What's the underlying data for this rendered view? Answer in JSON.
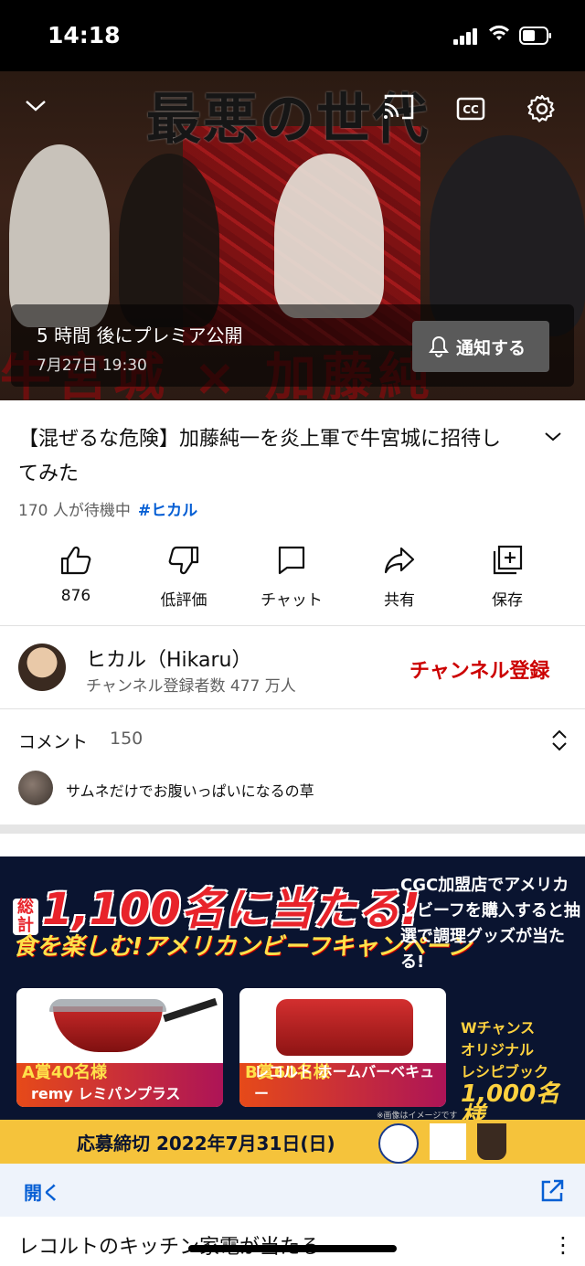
{
  "status_bar": {
    "time": "14:18"
  },
  "video": {
    "overlay_title": "最悪の世代",
    "overlay_bottom": "牛宮城 × 加藤純",
    "premiere_line1": "5 時間 後にプレミア公開",
    "premiere_line2": "7月27日 19:30",
    "notify_label": "通知する"
  },
  "info": {
    "title": "【混ぜるな危険】加藤純一を炎上軍で牛宮城に招待してみた",
    "waiting": "170 人が待機中",
    "hashtag": "#ヒカル"
  },
  "actions": {
    "like": "876",
    "dislike": "低評価",
    "chat": "チャット",
    "share": "共有",
    "save": "保存"
  },
  "channel": {
    "name": "ヒカル（Hikaru）",
    "subscribers": "チャンネル登録者数 477 万人",
    "subscribe_label": "チャンネル登録"
  },
  "comments": {
    "title": "コメント",
    "count": "150",
    "first_comment": "サムネだけでお腹いっぱいになるの草"
  },
  "ad": {
    "headline_small": "総計",
    "headline": "1,100名に当たる!",
    "subheadline": "食を楽しむ!アメリカンビーフキャンペーン",
    "side_text": "CGC加盟店でアメリカンビーフを購入すると抽選で調理グッズが当たる!",
    "prize_a_rank": "A賞40名様",
    "prize_a_name": "remy レミパンプラス",
    "prize_b_rank": "B賞60名様",
    "prize_b_name": "レコルト ホームバーベキュー",
    "w_chance_1": "Wチャンス",
    "w_chance_2": "オリジナル",
    "w_chance_3": "レシピブック",
    "w_chance_4": "1,000名様",
    "image_note": "※画像はイメージです",
    "deadline": "応募締切 2022年7月31日(日)",
    "open_label": "開く",
    "ad_title": "レコルトのキッチン家電が当たる"
  },
  "colors": {
    "accent_red": "#cc0000",
    "link_blue": "#065fd4"
  }
}
